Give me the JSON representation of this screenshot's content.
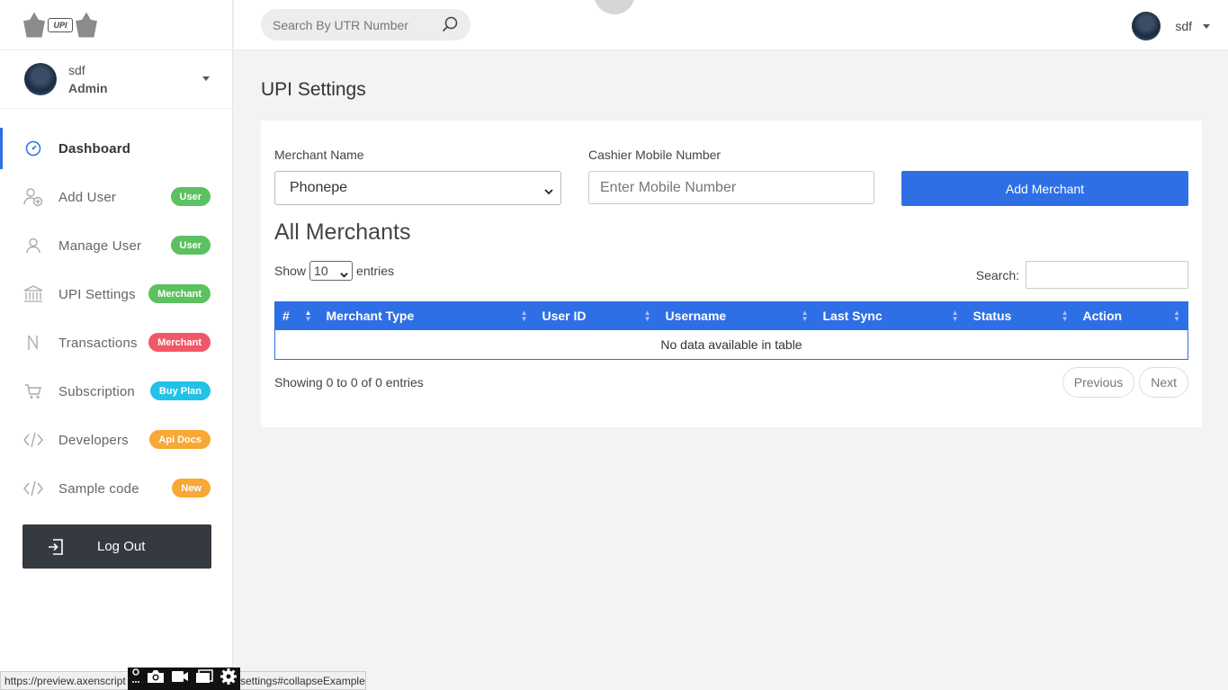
{
  "sidebar": {
    "user": {
      "name": "sdf",
      "role": "Admin"
    },
    "items": [
      {
        "key": "dashboard",
        "label": "Dashboard",
        "icon": "speedometer-icon",
        "badge": null,
        "active": true
      },
      {
        "key": "add-user",
        "label": "Add User",
        "icon": "add-user-icon",
        "badge": {
          "text": "User",
          "color": "#5cc160"
        }
      },
      {
        "key": "manage-user",
        "label": "Manage User",
        "icon": "user-icon",
        "badge": {
          "text": "User",
          "color": "#5cc160"
        }
      },
      {
        "key": "upi-settings",
        "label": "UPI Settings",
        "icon": "bank-icon",
        "badge": {
          "text": "Merchant",
          "color": "#5cc160"
        }
      },
      {
        "key": "transactions",
        "label": "Transactions",
        "icon": "rupee-icon",
        "badge": {
          "text": "Merchant",
          "color": "#f25767"
        }
      },
      {
        "key": "subscription",
        "label": "Subscription",
        "icon": "cart-icon",
        "badge": {
          "text": "Buy Plan",
          "color": "#22c2e6"
        }
      },
      {
        "key": "developers",
        "label": "Developers",
        "icon": "code-icon",
        "badge": {
          "text": "Api Docs",
          "color": "#f7a836"
        }
      },
      {
        "key": "sample-code",
        "label": "Sample code",
        "icon": "code-icon",
        "badge": {
          "text": "New",
          "color": "#f7a836"
        }
      }
    ],
    "logout_label": "Log Out"
  },
  "topbar": {
    "search_placeholder": "Search By UTR Number",
    "user_name": "sdf"
  },
  "main": {
    "page_title": "UPI Settings",
    "form": {
      "merchant_label": "Merchant Name",
      "merchant_value": "Phonepe",
      "mobile_label": "Cashier Mobile Number",
      "mobile_placeholder": "Enter Mobile Number",
      "add_button": "Add Merchant"
    },
    "section_title": "All Merchants",
    "show_label": "Show",
    "entries_label": "entries",
    "page_length": "10",
    "search_label": "Search:",
    "columns": [
      "#",
      "Merchant Type",
      "User ID",
      "Username",
      "Last Sync",
      "Status",
      "Action"
    ],
    "empty_text": "No data available in table",
    "info_text": "Showing 0 to 0 of 0 entries",
    "prev_label": "Previous",
    "next_label": "Next"
  },
  "statusbar": {
    "url_left": "https://preview.axenscript",
    "url_right": "settings#collapseExample"
  },
  "colors": {
    "primary": "#2f6fe6",
    "sidebar_dark": "#343a40"
  }
}
